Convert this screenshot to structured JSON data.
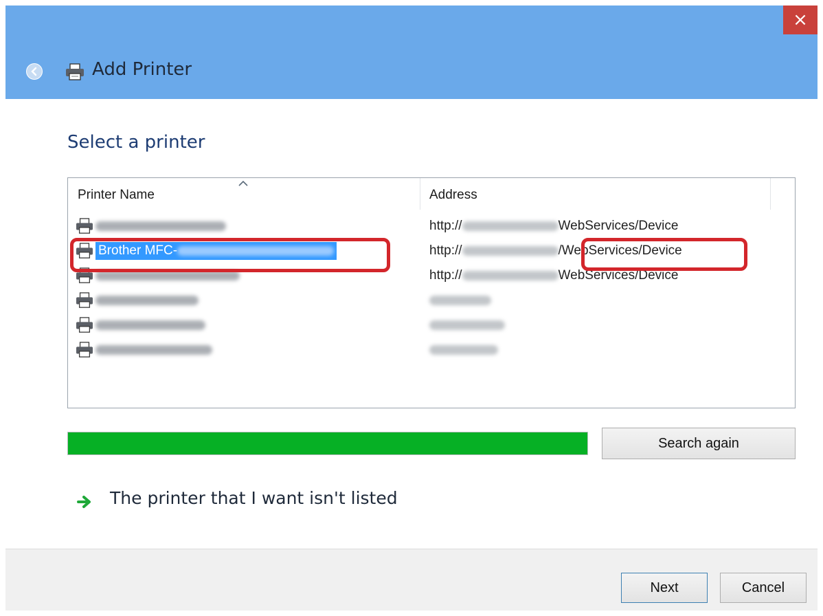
{
  "window": {
    "title": "Add Printer",
    "close_glyph": "×",
    "title_bar_color": "#6aa9ea",
    "close_color": "#c9413b"
  },
  "heading": "Select a printer",
  "table": {
    "columns": [
      "Printer Name",
      "Address"
    ],
    "rows": [
      {
        "name": "",
        "address_prefix": "http://",
        "address_suffix": "WebServices/Device",
        "selected": false
      },
      {
        "name": "Brother MFC-",
        "address_prefix": "http://",
        "address_suffix": "/WebServices/Device",
        "selected": true
      },
      {
        "name": "",
        "address_prefix": "http://",
        "address_suffix": "WebServices/Device",
        "selected": false
      },
      {
        "name": "",
        "address_prefix": "",
        "address_suffix": "",
        "selected": false
      },
      {
        "name": "",
        "address_prefix": "",
        "address_suffix": "",
        "selected": false
      },
      {
        "name": "",
        "address_prefix": "",
        "address_suffix": "",
        "selected": false
      }
    ]
  },
  "progress": {
    "value": 1.0,
    "color": "#06b025"
  },
  "buttons": {
    "search_again": "Search again",
    "next": "Next",
    "cancel": "Cancel"
  },
  "not_listed_link": "The printer that I want isn't listed",
  "icons": {
    "back": "back-arrow-icon",
    "printer": "printer-icon",
    "sort": "sort-up-icon",
    "link_arrow": "green-arrow-icon"
  },
  "accent": {
    "selection": "#3399ff",
    "annotation": "#d3262b"
  }
}
